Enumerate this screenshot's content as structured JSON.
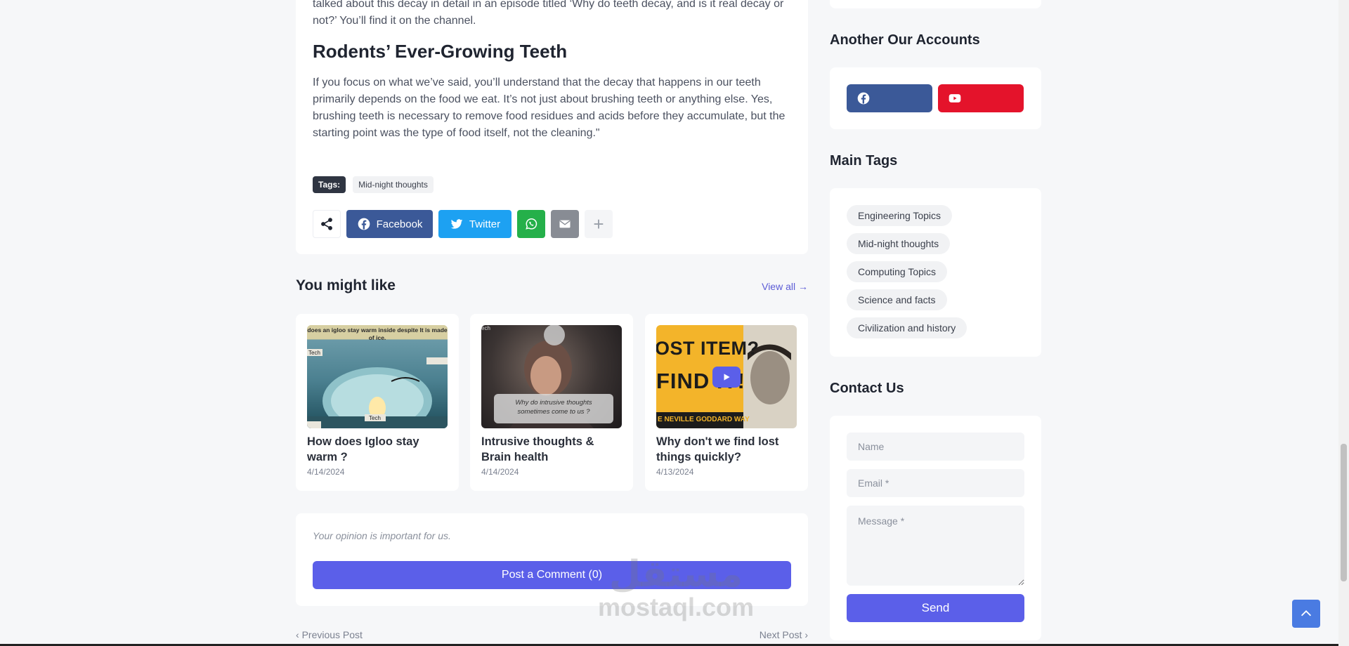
{
  "article": {
    "intro_text": "talked about this decay in detail in an episode titled ‘Why do teeth decay, and is it real decay or not?’ You’ll find it on the channel.",
    "heading": "Rodents’ Ever-Growing Teeth",
    "paragraph": "If you focus on what we’ve said, you’ll understand that the decay that happens in our teeth primarily depends on the food we eat. It’s not just about brushing teeth or anything else. Yes, brushing teeth is necessary to remove food residues and acids before they accumulate, but the starting point was the type of food itself, not the cleaning.\"",
    "tags_label": "Tags:",
    "tags": [
      "Mid-night thoughts"
    ],
    "share": {
      "facebook_label": "Facebook",
      "twitter_label": "Twitter",
      "plus_label": "+"
    }
  },
  "related": {
    "title": "You might like",
    "view_all": "View all →",
    "posts": [
      {
        "title": "How does Igloo stay warm ?",
        "date": "4/14/2024",
        "thumb_text": "does an igloo stay warm inside despite It is made of ice.",
        "thumb_tag": "Tech"
      },
      {
        "title": "Intrusive thoughts & Brain health",
        "date": "4/14/2024",
        "thumb_text": "Why do intrusive thoughts sometimes come to us ?",
        "thumb_tag": "ech"
      },
      {
        "title": "Why don't we find lost things quickly?",
        "date": "4/13/2024",
        "thumb_text_top": "OST ITEM?",
        "thumb_text_mid": "FIND IT!",
        "thumb_text_bottom": "E NEVILLE GODDARD WAY"
      }
    ]
  },
  "comments": {
    "hint": "Your opinion is important for us.",
    "button": "Post a Comment (0)"
  },
  "post_nav": {
    "previous": "Previous Post",
    "next": "Next Post"
  },
  "sidebar": {
    "accounts_title": "Another Our Accounts",
    "tags_title": "Main Tags",
    "tags": [
      "Engineering Topics",
      "Mid-night thoughts",
      "Computing Topics",
      "Science and facts",
      "Civilization and history"
    ],
    "contact_title": "Contact Us",
    "contact": {
      "name_placeholder": "Name",
      "email_placeholder": "Email *",
      "message_placeholder": "Message *",
      "send": "Send"
    }
  },
  "watermark": {
    "arabic": "مستقل",
    "latin": "mostaql.com"
  },
  "colors": {
    "accent": "#5b5fe9",
    "facebook": "#3b5998",
    "twitter": "#1da1f2",
    "whatsapp": "#25b04a",
    "youtube": "#e4132b"
  }
}
